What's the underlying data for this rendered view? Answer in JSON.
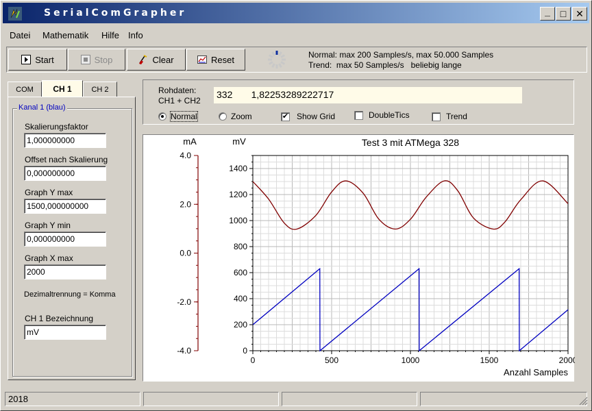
{
  "window": {
    "title": "SerialComGrapher",
    "icon": "lightning-app-icon"
  },
  "titlebar_buttons": {
    "minimize": "_",
    "maximize": "□",
    "close": "✕"
  },
  "menu": [
    "Datei",
    "Mathematik",
    "Hilfe",
    "Info"
  ],
  "toolbar": {
    "start_label": "Start",
    "stop_label": "Stop",
    "clear_label": "Clear",
    "reset_label": "Reset",
    "info_line1": "Normal: max 200 Samples/s, max 50.000 Samples",
    "info_line2": "Trend:  max 50 Samples/s   beliebig lange"
  },
  "tabs": [
    "COM",
    "CH 1",
    "CH 2"
  ],
  "active_tab": "CH 1",
  "channel": {
    "group_title": "Kanal 1 (blau)",
    "scaling_label": "Skalierungsfaktor",
    "scaling_value": "1,000000000",
    "offset_label": "Offset nach Skalierung",
    "offset_value": "0,000000000",
    "ymax_label": "Graph  Y max",
    "ymax_value": "1500,000000000",
    "ymin_label": "Graph  Y min",
    "ymin_value": "0,000000000",
    "xmax_label": "Graph  X max",
    "xmax_value": "2000",
    "decimal_note": "Dezimaltrennung = Komma",
    "name_label": "CH 1   Bezeichnung",
    "name_value": "mV"
  },
  "raw": {
    "label": "Rohdaten:\nCH1 + CH2",
    "value": "332       1,82253289222717"
  },
  "options": {
    "normal_label": "Normal",
    "zoom_label": "Zoom",
    "show_grid_label": "Show Grid",
    "double_tics_label": "DoubleTics",
    "trend_label": "Trend",
    "mode": "Normal",
    "show_grid": true,
    "double_tics": false,
    "trend": false
  },
  "chart_data": {
    "type": "line",
    "title": "Test 3 mit ATMega 328",
    "xlabel": "Anzahl Samples",
    "left_axis": {
      "unit": "mA",
      "ylim": [
        -4.0,
        4.0
      ],
      "ticks": [
        "4.0",
        "2.0",
        "0.0",
        "-2.0",
        "-4.0"
      ],
      "color": "#800000"
    },
    "right_axis": {
      "unit": "mV",
      "ylim": [
        0,
        1500
      ],
      "ticks": [
        "1400",
        "1200",
        "1000",
        "800",
        "600",
        "400",
        "200",
        "0"
      ]
    },
    "x_ticks": [
      "0",
      "500",
      "1000",
      "1500",
      "2000"
    ],
    "xlim": [
      0,
      2000
    ],
    "grid": true,
    "series": [
      {
        "color": "#800000",
        "kind": "sine",
        "x": [
          0,
          100,
          200,
          280,
          400,
          500,
          590,
          700,
          800,
          905,
          1000,
          1100,
          1215,
          1300,
          1400,
          1525,
          1600,
          1700,
          1840,
          2000
        ],
        "values": [
          1300,
          1165,
          980,
          935,
          1040,
          1220,
          1305,
          1210,
          1010,
          935,
          1010,
          1180,
          1305,
          1230,
          1020,
          935,
          990,
          1160,
          1305,
          1130
        ]
      },
      {
        "color": "#0000c0",
        "kind": "sawtooth",
        "x": [
          0,
          425,
          426,
          1055,
          1056,
          1690,
          1691,
          2000
        ],
        "values": [
          200,
          630,
          0,
          630,
          0,
          630,
          0,
          315
        ]
      }
    ]
  },
  "status": {
    "cell1": "2018"
  }
}
